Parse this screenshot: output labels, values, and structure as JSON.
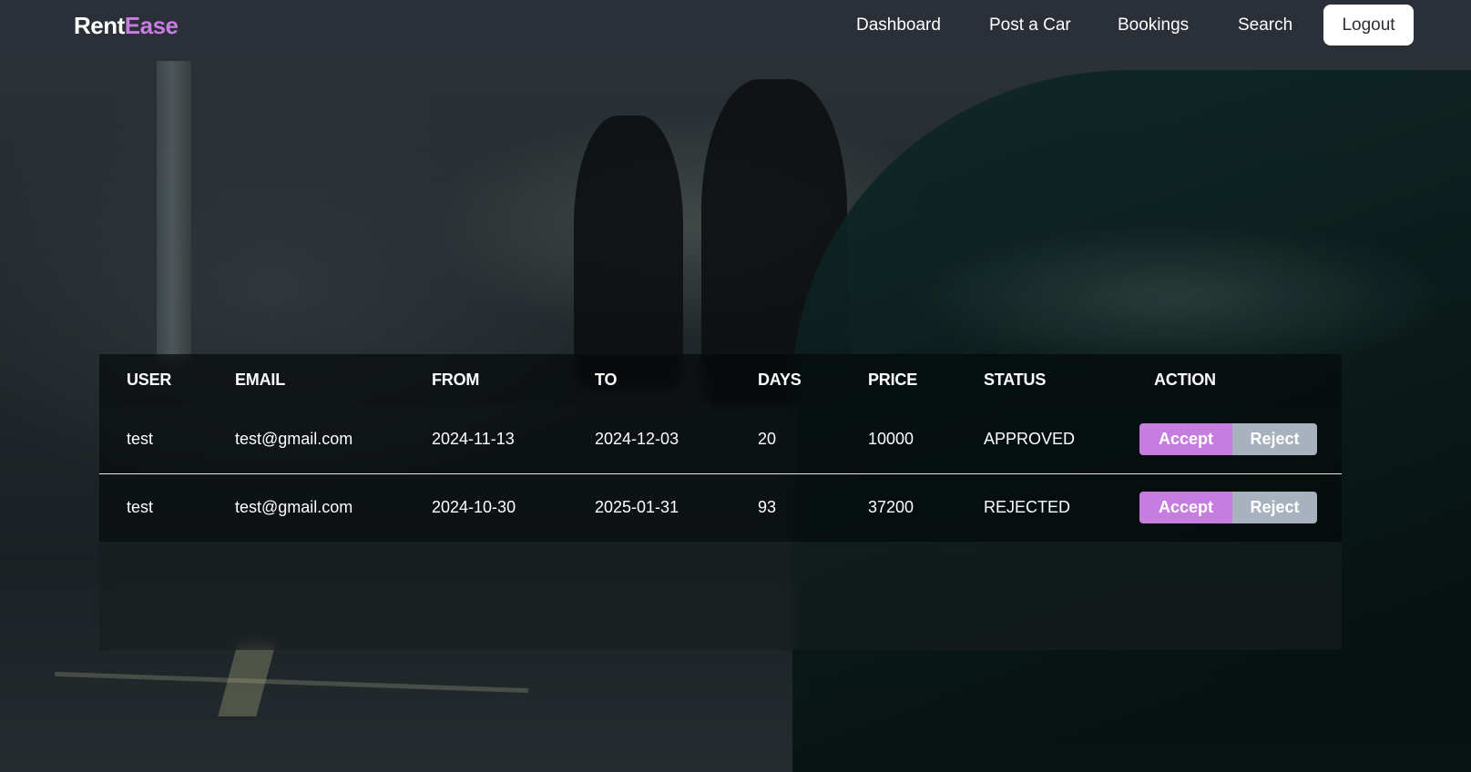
{
  "brand": {
    "part1": "Rent",
    "part2": "Ease"
  },
  "nav": {
    "items": [
      {
        "label": "Dashboard"
      },
      {
        "label": "Post a Car"
      },
      {
        "label": "Bookings"
      },
      {
        "label": "Search"
      }
    ],
    "logout_label": "Logout"
  },
  "table": {
    "headers": [
      "USER",
      "EMAIL",
      "FROM",
      "TO",
      "DAYS",
      "PRICE",
      "STATUS",
      "ACTION"
    ],
    "rows": [
      {
        "user": "test",
        "email": "test@gmail.com",
        "from": "2024-11-13",
        "to": "2024-12-03",
        "days": "20",
        "price": "10000",
        "status": "APPROVED",
        "accept_label": "Accept",
        "reject_label": "Reject"
      },
      {
        "user": "test",
        "email": "test@gmail.com",
        "from": "2024-10-30",
        "to": "2025-01-31",
        "days": "93",
        "price": "37200",
        "status": "REJECTED",
        "accept_label": "Accept",
        "reject_label": "Reject"
      }
    ]
  },
  "colors": {
    "navbar": "#2b2f38",
    "brand_accent": "#c77de0",
    "accept_button": "#c77de0",
    "reject_button": "#a8b1be"
  },
  "background_image": "dark street scene with people and a green car"
}
